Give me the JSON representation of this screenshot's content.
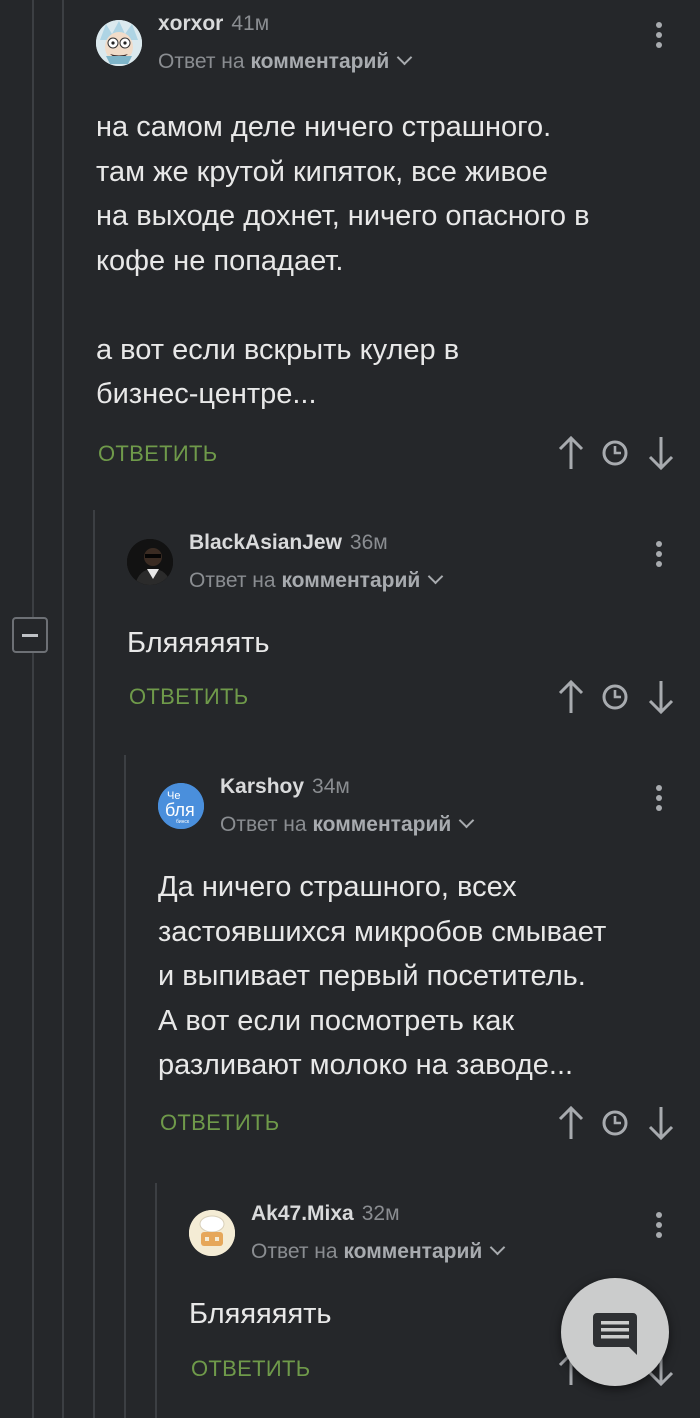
{
  "comments": [
    {
      "author": "xorxor",
      "time": "41м",
      "reply_prefix": "Ответ на",
      "reply_target": "комментарий",
      "text": "на самом деле ничего страшного.\nтам же крутой кипяток, все живое\nна выходе дохнет, ничего опасного в\nкофе не попадает.\n\nа вот если вскрыть кулер в\nбизнес-центре...",
      "reply_label": "ОТВЕТИТЬ"
    },
    {
      "author": "BlackAsianJew",
      "time": "36м",
      "reply_prefix": "Ответ на",
      "reply_target": "комментарий",
      "text": "Бляяяяять",
      "reply_label": "ОТВЕТИТЬ"
    },
    {
      "author": "Karshoy",
      "time": "34м",
      "reply_prefix": "Ответ на",
      "reply_target": "комментарий",
      "avatar_text": [
        "Че",
        "бля",
        "бинск"
      ],
      "text": "Да ничего страшного, всех\nзастоявшихся микробов смывает\nи выпивает первый посетитель.\nА вот если посмотреть как\nразливают молоко на заводе...",
      "reply_label": "ОТВЕТИТЬ"
    },
    {
      "author": "Ak47.Mixa",
      "time": "32м",
      "reply_prefix": "Ответ на",
      "reply_target": "комментарий",
      "text": "Бляяяяять",
      "reply_label": "ОТВЕТИТЬ"
    }
  ],
  "icons": {
    "upvote": "arrow-up-icon",
    "save": "clock-icon",
    "downvote": "arrow-down-icon",
    "more": "kebab-menu-icon",
    "collapse": "minus-icon",
    "fab": "comment-icon"
  },
  "colors": {
    "background": "#25272a",
    "reply_green": "#6f9a4a",
    "muted_text": "#8a8d91",
    "body_text": "#e8e8e8",
    "fab": "#cbcccc"
  }
}
